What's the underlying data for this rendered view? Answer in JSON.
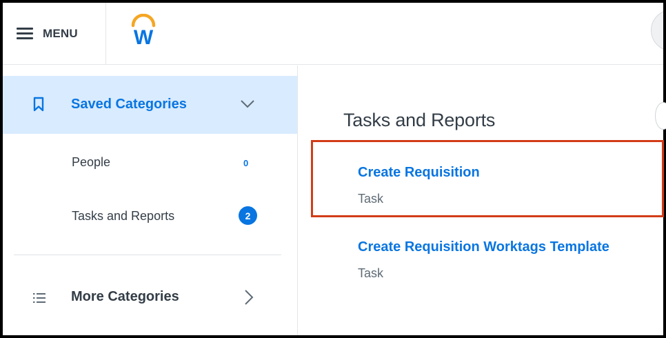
{
  "header": {
    "menu_label": "MENU",
    "logo_letter": "W"
  },
  "sidebar": {
    "saved_categories": {
      "label": "Saved Categories",
      "icon": "bookmark-icon",
      "expanded": true
    },
    "items": [
      {
        "label": "People",
        "count": "0",
        "count_style": "plain"
      },
      {
        "label": "Tasks and Reports",
        "count": "2",
        "count_style": "badge"
      }
    ],
    "more_categories": {
      "label": "More Categories",
      "icon": "list-icon"
    }
  },
  "main": {
    "section_title": "Tasks and Reports",
    "results": [
      {
        "title": "Create Requisition",
        "type": "Task",
        "highlighted": true
      },
      {
        "title": "Create Requisition Worktags Template",
        "type": "Task",
        "highlighted": false
      }
    ]
  },
  "colors": {
    "accent_blue": "#0875e1",
    "selected_bg": "#d9ebff",
    "text_dark": "#333d47",
    "text_muted": "#5e6a75",
    "highlight_red": "#d23c17",
    "logo_orange": "#f5a623"
  }
}
